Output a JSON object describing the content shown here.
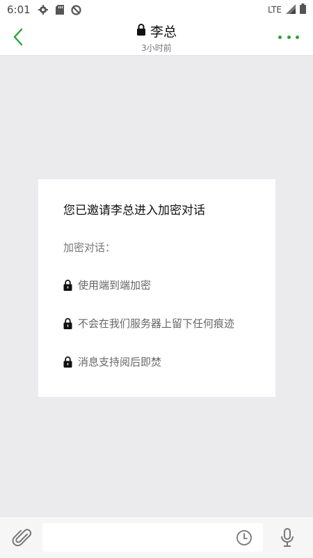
{
  "status_bar": {
    "time": "6:01",
    "network": "LTE",
    "icons": [
      "gear-icon",
      "sd-card-icon",
      "do-not-disturb-icon",
      "signal-icon",
      "battery-icon"
    ]
  },
  "header": {
    "title": "李总",
    "subtitle": "3小时前",
    "back_icon": "back-chevron-icon",
    "lock_icon": "lock-icon",
    "more_icon": "more-dots-icon"
  },
  "card": {
    "title": "您已邀请李总进入加密对话",
    "label": "加密对话：",
    "items": [
      "使用端到端加密",
      "不会在我们服务器上留下任何痕迹",
      "消息支持阅后即焚"
    ]
  },
  "composer": {
    "input_value": "",
    "placeholder": "",
    "attach_icon": "paperclip-icon",
    "timer_icon": "clock-icon",
    "mic_icon": "microphone-icon"
  },
  "colors": {
    "accent": "#2aa23b",
    "background": "#ebeaed",
    "card": "#ffffff"
  }
}
